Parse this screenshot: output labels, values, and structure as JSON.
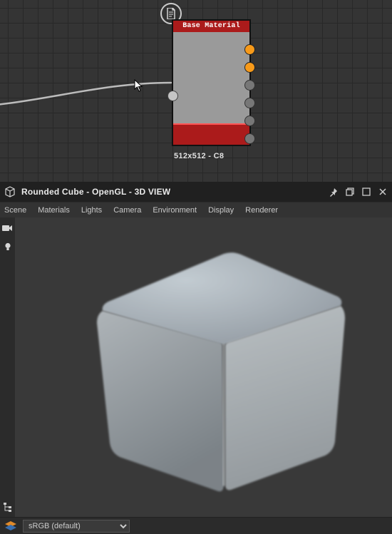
{
  "node": {
    "title": "Base Material",
    "caption": "512x512 - C8",
    "ports_right": [
      {
        "active": true
      },
      {
        "active": true
      },
      {
        "active": false
      },
      {
        "active": false
      },
      {
        "active": false
      },
      {
        "active": false
      }
    ]
  },
  "view": {
    "title": "Rounded Cube - OpenGL - 3D VIEW",
    "menu": {
      "scene": "Scene",
      "materials": "Materials",
      "lights": "Lights",
      "camera": "Camera",
      "environment": "Environment",
      "display": "Display",
      "renderer": "Renderer"
    }
  },
  "status": {
    "colorspace": "sRGB (default)"
  }
}
